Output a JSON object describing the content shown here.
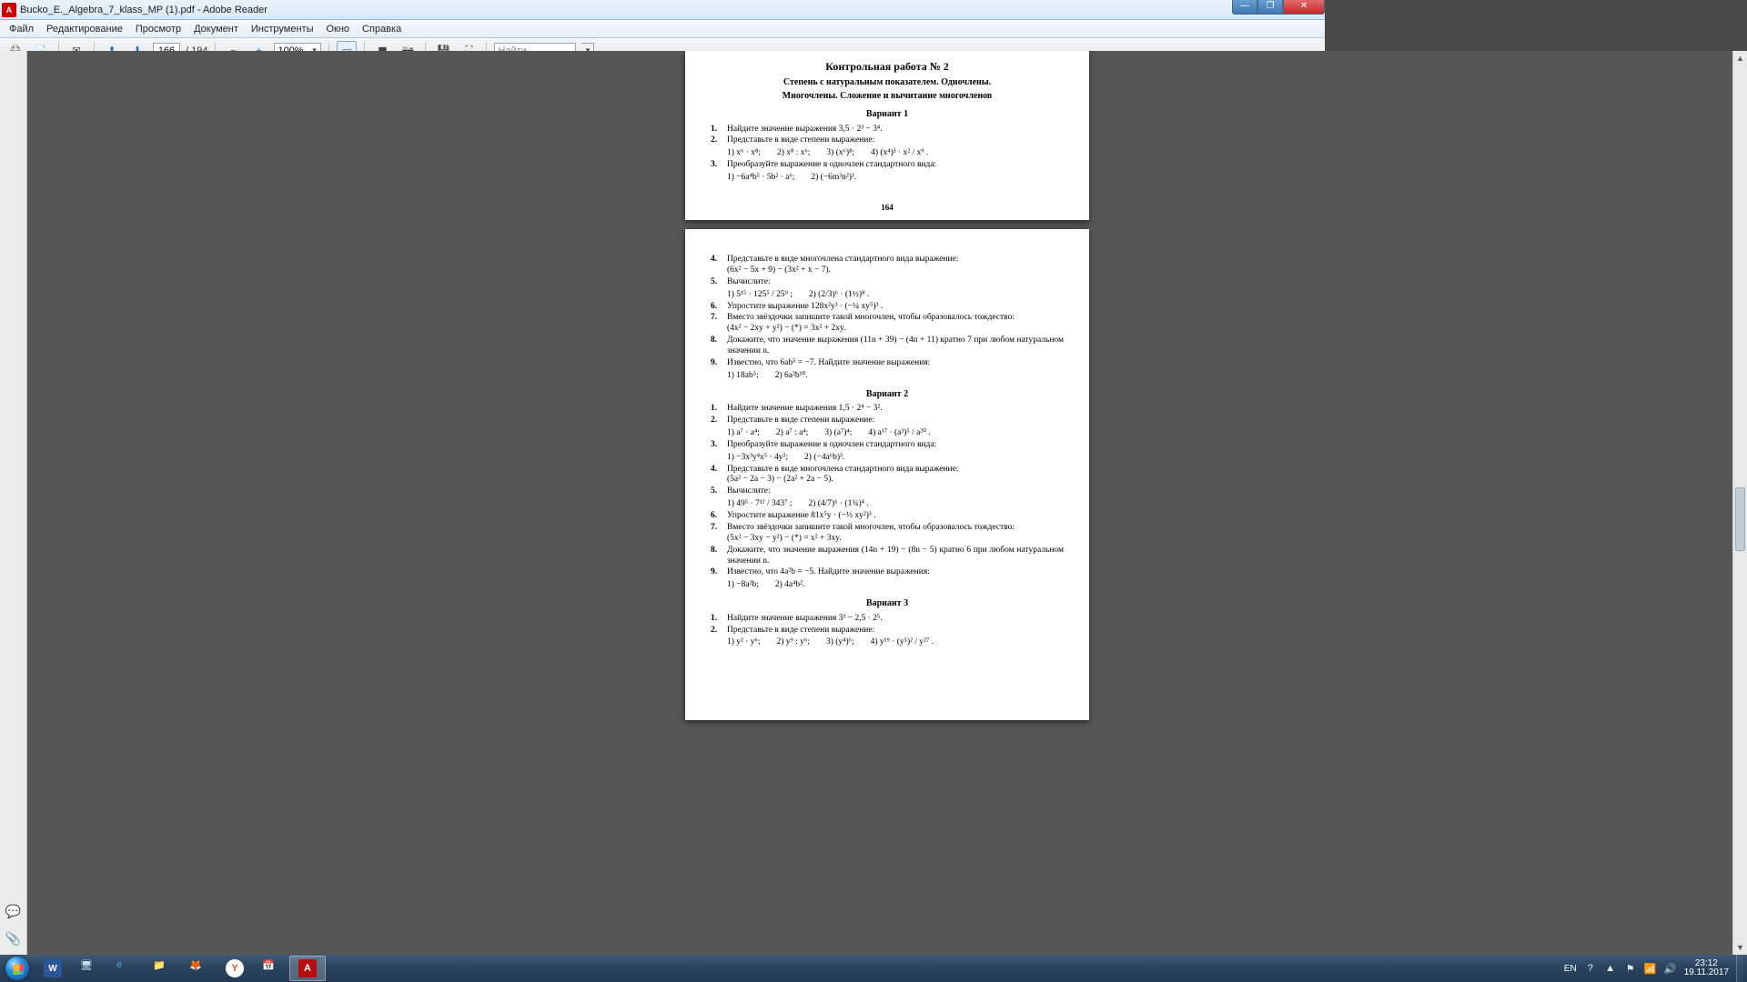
{
  "titlebar": {
    "filename": "Bucko_E._Algebra_7_klass_MP (1).pdf",
    "app": "Adobe Reader"
  },
  "menu": [
    "Файл",
    "Редактирование",
    "Просмотр",
    "Документ",
    "Инструменты",
    "Окно",
    "Справка"
  ],
  "toolbar": {
    "page_current": "166",
    "page_total": "/ 194",
    "zoom": "100%",
    "find_placeholder": "Найти"
  },
  "document": {
    "title": "Контрольная работа № 2",
    "subtitle1": "Степень с натуральным показателем. Одночлены.",
    "subtitle2": "Многочлены. Сложение и вычитание многочленов",
    "page_number_164": "164",
    "variant1": {
      "heading": "Вариант 1",
      "tasks": [
        {
          "n": "1.",
          "text": "Найдите значение выражения 3,5 · 2³ − 3⁴."
        },
        {
          "n": "2.",
          "text": "Представьте в виде степени выражение:",
          "items": [
            "1) x⁶ · x⁸;",
            "2) x⁸ : x⁶;",
            "3) (x⁶)⁸;",
            "4) (x⁴)³ · x² / x⁹ ."
          ]
        },
        {
          "n": "3.",
          "text": "Преобразуйте выражение в одночлен стандартного вида:",
          "items": [
            "1) −6a⁴b⁵ · 5b² · a⁶;",
            "2) (−6m³n²)³."
          ]
        }
      ]
    },
    "page165": {
      "tasks_cont": [
        {
          "n": "4.",
          "text": "Представьте в виде многочлена стандартного вида выражение:",
          "line": "(6x² − 5x + 9) − (3x² + x − 7)."
        },
        {
          "n": "5.",
          "text": "Вычислите:",
          "items": [
            "1) 5¹⁵ · 125⁵ / 25⁹ ;",
            "2) (2/3)⁶ · (1½)⁸ ."
          ]
        },
        {
          "n": "6.",
          "text": "Упростите выражение 128x²y³ · (−¼ xy⁵)³ ."
        },
        {
          "n": "7.",
          "text": "Вместо звёздочки запишите такой многочлен, чтобы образовалось тождество:",
          "line": "(4x² − 2xy + y²) − (*) = 3x² + 2xy."
        },
        {
          "n": "8.",
          "text": "Докажите, что значение выражения (11n + 39) − (4n + 11) кратно 7 при любом натуральном значении n."
        },
        {
          "n": "9.",
          "text": "Известно, что 6ab⁵ = −7. Найдите значение выражения:",
          "items": [
            "1) 18ab⁵;",
            "2) 6a²b¹⁰."
          ]
        }
      ]
    },
    "variant2": {
      "heading": "Вариант 2",
      "tasks": [
        {
          "n": "1.",
          "text": "Найдите значение выражения 1,5 · 2⁴ − 3²."
        },
        {
          "n": "2.",
          "text": "Представьте в виде степени выражение:",
          "items": [
            "1) a⁷ · a⁴;",
            "2) a⁷ : a⁴;",
            "3) (a⁷)⁴;",
            "4) a¹⁷ · (a³)⁵ / a²⁰ ."
          ]
        },
        {
          "n": "3.",
          "text": "Преобразуйте выражение в одночлен стандартного вида:",
          "items": [
            "1) −3x³y⁴x⁵ · 4y³;",
            "2) (−4a⁶b)³."
          ]
        },
        {
          "n": "4.",
          "text": "Представьте в виде многочлена стандартного вида выражение:",
          "line": "(5a² − 2a − 3) − (2a² + 2a − 5)."
        },
        {
          "n": "5.",
          "text": "Вычислите:",
          "items": [
            "1) 49⁵ · 7¹² / 343⁷ ;",
            "2) (4/7)⁶ · (1¾)⁴ ."
          ]
        },
        {
          "n": "6.",
          "text": "Упростите выражение 81x⁵y · (−⅓ xy²)³ ."
        },
        {
          "n": "7.",
          "text": "Вместо звёздочки запишите такой многочлен, чтобы образовалось тождество:",
          "line": "(5x² − 3xy − y²) − (*) = x² + 3xy."
        },
        {
          "n": "8.",
          "text": "Докажите, что значение выражения (14n + 19) − (8n − 5) кратно 6 при любом натуральном значении n."
        },
        {
          "n": "9.",
          "text": "Известно, что 4a²b = −5. Найдите значение выражения:",
          "items": [
            "1) −8a²b;",
            "2) 4a⁴b²."
          ]
        }
      ]
    },
    "variant3": {
      "heading": "Вариант 3",
      "tasks": [
        {
          "n": "1.",
          "text": "Найдите значение выражения 3³ − 2,5 · 2⁵."
        },
        {
          "n": "2.",
          "text": "Представьте в виде степени выражение:",
          "items": [
            "1) y² · y⁶;",
            "2) y⁹ : y⁶;",
            "3) (y⁴)⁶;",
            "4) y¹⁹ · (y⁵)² / y²⁷ ."
          ]
        }
      ]
    }
  },
  "taskbar": {
    "lang": "EN",
    "time": "23:12",
    "date": "19.11.2017"
  }
}
